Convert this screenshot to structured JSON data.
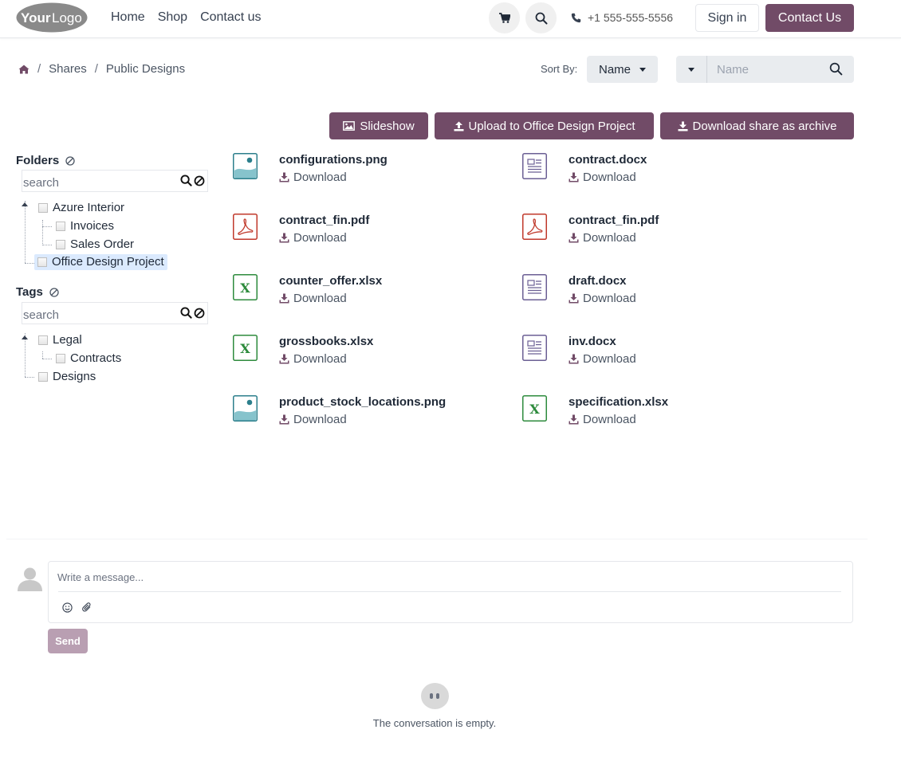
{
  "brand": {
    "logo_text_your": "Your",
    "logo_text_logo": "Logo",
    "accent": "#714b67"
  },
  "nav": [
    "Home",
    "Shop",
    "Contact us"
  ],
  "header": {
    "phone": "+1 555-555-5556",
    "sign_in": "Sign in",
    "contact_us": "Contact Us",
    "cart_icon": "cart-icon",
    "search_icon": "search-icon",
    "phone_icon": "phone-icon"
  },
  "breadcrumb": {
    "home_icon": "home-icon",
    "items": [
      "Shares",
      "Public Designs"
    ],
    "separator": "/"
  },
  "sort": {
    "label": "Sort By:",
    "value": "Name"
  },
  "search": {
    "placeholder": "Name"
  },
  "actions": {
    "slideshow": "Slideshow",
    "upload": "Upload to Office Design Project",
    "download_archive": "Download share as archive"
  },
  "folders": {
    "title": "Folders",
    "search_placeholder": "search",
    "items": [
      {
        "label": "Azure Interior",
        "depth": 0
      },
      {
        "label": "Invoices",
        "depth": 1
      },
      {
        "label": "Sales Order",
        "depth": 1
      },
      {
        "label": "Office Design Project",
        "depth": 0,
        "selected": true
      }
    ]
  },
  "tags": {
    "title": "Tags",
    "search_placeholder": "search",
    "items": [
      {
        "label": "Legal",
        "depth": 0
      },
      {
        "label": "Contracts",
        "depth": 1
      },
      {
        "label": "Designs",
        "depth": 0
      }
    ]
  },
  "files": {
    "download_label": "Download",
    "items": [
      {
        "name": "configurations.png",
        "kind": "image"
      },
      {
        "name": "contract.docx",
        "kind": "doc"
      },
      {
        "name": "contract_fin.pdf",
        "kind": "pdf"
      },
      {
        "name": "contract_fin.pdf",
        "kind": "pdf"
      },
      {
        "name": "counter_offer.xlsx",
        "kind": "xls"
      },
      {
        "name": "draft.docx",
        "kind": "doc"
      },
      {
        "name": "grossbooks.xlsx",
        "kind": "xls"
      },
      {
        "name": "inv.docx",
        "kind": "doc"
      },
      {
        "name": "product_stock_locations.png",
        "kind": "image"
      },
      {
        "name": "specification.xlsx",
        "kind": "xls"
      }
    ]
  },
  "chatter": {
    "placeholder": "Write a message...",
    "send": "Send",
    "empty": "The conversation is empty."
  }
}
